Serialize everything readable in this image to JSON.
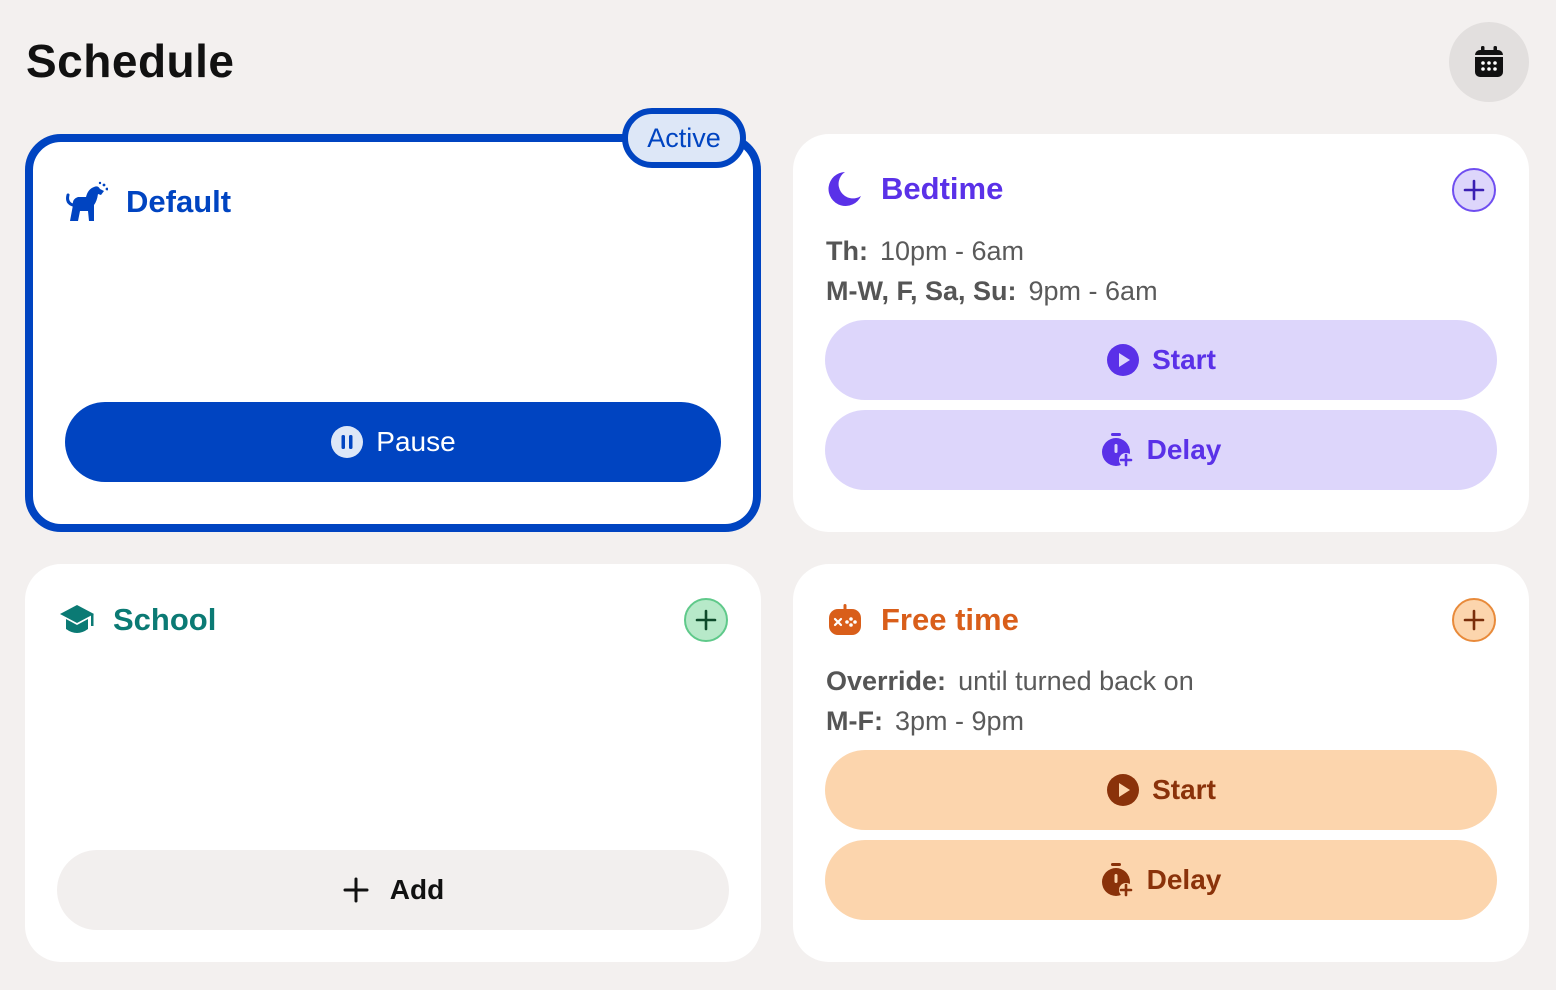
{
  "page": {
    "title": "Schedule"
  },
  "header": {
    "calendar_icon": "calendar-icon"
  },
  "cards": {
    "default": {
      "name": "Default",
      "badge": "Active",
      "icon": "dog-icon",
      "primary_button": "Pause",
      "primary_icon": "pause-circle-icon",
      "color": "#0044c1"
    },
    "bedtime": {
      "name": "Bedtime",
      "icon": "moon-icon",
      "color": "#5a31e8",
      "schedules": [
        {
          "days": "Th:",
          "time": "10pm - 6am"
        },
        {
          "days": "M-W, F, Sa, Su:",
          "time": "9pm - 6am"
        }
      ],
      "start_label": "Start",
      "delay_label": "Delay"
    },
    "school": {
      "name": "School",
      "icon": "graduation-cap-icon",
      "color": "#0b7a74",
      "add_label": "Add"
    },
    "free_time": {
      "name": "Free time",
      "icon": "game-controller-icon",
      "color": "#d95e1a",
      "schedules": [
        {
          "days": "Override:",
          "time": "until turned back on"
        },
        {
          "days": "M-F:",
          "time": "3pm - 9pm"
        }
      ],
      "start_label": "Start",
      "delay_label": "Delay"
    }
  }
}
